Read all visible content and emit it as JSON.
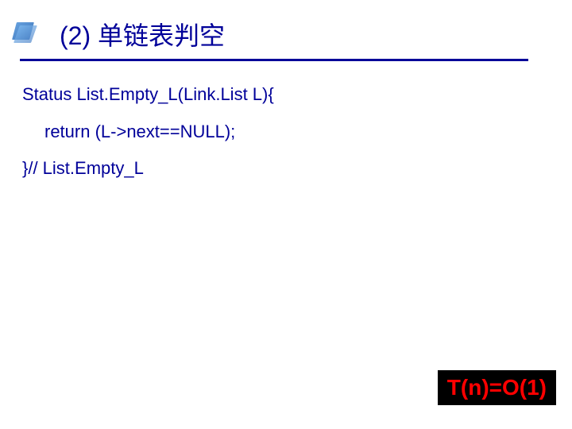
{
  "slide": {
    "title": "(2) 单链表判空",
    "code": {
      "line1": "Status List.Empty_L(Link.List L){",
      "line2": "return (L->next==NULL);",
      "line3": "}// List.Empty_L"
    },
    "complexity": "T(n)=O(1)"
  }
}
